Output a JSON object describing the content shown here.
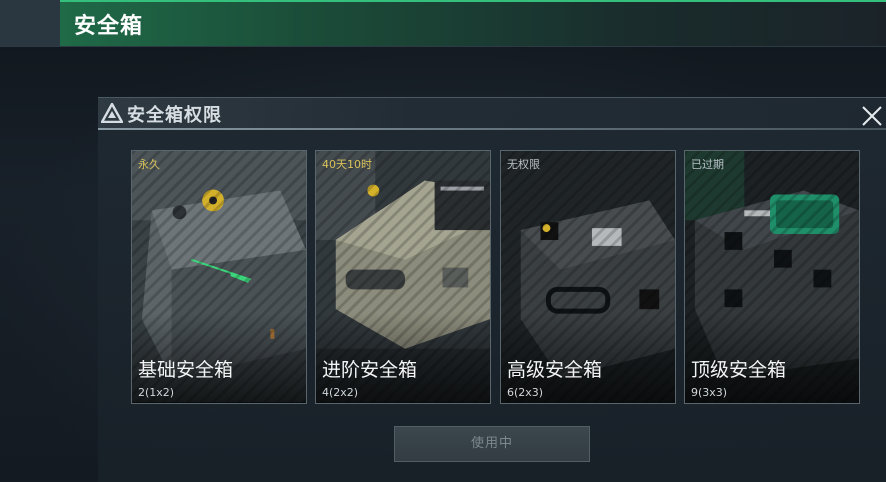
{
  "header": {
    "title": "安全箱"
  },
  "dialog": {
    "title": "安全箱权限"
  },
  "cards": [
    {
      "status": "永久",
      "name": "基础安全箱",
      "capacity": "2(1x2)"
    },
    {
      "status": "40天10时",
      "name": "进阶安全箱",
      "capacity": "4(2x2)"
    },
    {
      "status": "无权限",
      "name": "高级安全箱",
      "capacity": "6(2x3)"
    },
    {
      "status": "已过期",
      "name": "顶级安全箱",
      "capacity": "9(3x3)"
    }
  ],
  "action": {
    "label": "使用中"
  },
  "colors": {
    "accent": "#34c07c",
    "status_active": "#d8c25a",
    "status_inactive": "#b8c0c6"
  }
}
